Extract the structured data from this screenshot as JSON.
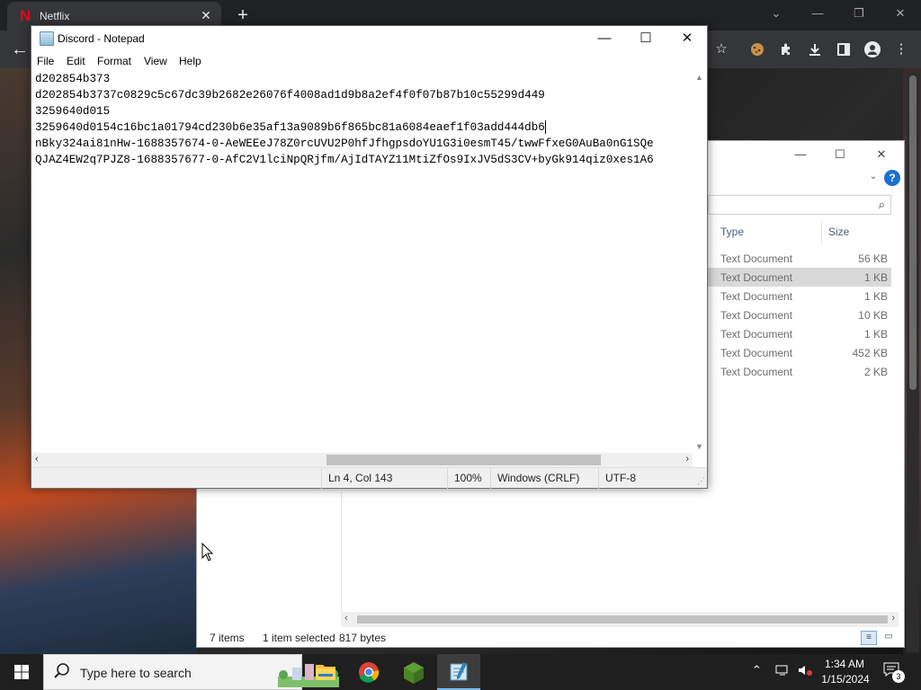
{
  "chrome": {
    "tab_title": "Netflix",
    "tab_close": "✕",
    "new_tab": "+",
    "back": "←",
    "minimize": "—",
    "restore": "❐",
    "close": "✕",
    "toolbar_icons": [
      "star-icon",
      "cookie-icon",
      "extensions-icon",
      "download-icon",
      "side-panel-icon",
      "profile-icon",
      "menu-icon"
    ]
  },
  "explorer": {
    "columns": {
      "type": "Type",
      "size": "Size"
    },
    "files": [
      {
        "type": "Text Document",
        "size": "56 KB",
        "selected": false
      },
      {
        "type": "Text Document",
        "size": "1 KB",
        "selected": true
      },
      {
        "type": "Text Document",
        "size": "1 KB",
        "selected": false
      },
      {
        "type": "Text Document",
        "size": "10 KB",
        "selected": false
      },
      {
        "type": "Text Document",
        "size": "1 KB",
        "selected": false
      },
      {
        "type": "Text Document",
        "size": "452 KB",
        "selected": false
      },
      {
        "type": "Text Document",
        "size": "2 KB",
        "selected": false
      }
    ],
    "status": {
      "items": "7 items",
      "selected": "1 item selected",
      "bytes": "817 bytes"
    },
    "help": "?"
  },
  "notepad": {
    "title": "Discord - Notepad",
    "menu": [
      "File",
      "Edit",
      "Format",
      "View",
      "Help"
    ],
    "lines": [
      "d202854b373",
      "d202854b3737c0829c5c67dc39b2682e26076f4008ad1d9b8a2ef4f0f07b87b10c55299d449",
      "3259640d015",
      "3259640d0154c16bc1a01794cd230b6e35af13a9089b6f865bc81a6084eaef1f03add444db6",
      "nBky324ai81nHw-1688357674-0-AeWEEeJ78Z0rcUVU2P0hfJfhgpsdoYU1G3i0esmT45/twwFfxeG0AuBa0nG1SQe",
      "QJAZ4EW2q7PJZ8-1688357677-0-AfC2V1lciNpQRjfm/AjIdTAYZ11MtiZfOs9IxJV5dS3CV+byGk914qiz0xes1A6"
    ],
    "status": {
      "position": "Ln 4, Col 143",
      "zoom": "100%",
      "line_ending": "Windows (CRLF)",
      "encoding": "UTF-8"
    }
  },
  "taskbar": {
    "search_placeholder": "Type here to search",
    "apps": [
      "file-explorer",
      "chrome",
      "minecraft-launcher",
      "notepad"
    ],
    "time": "1:34 AM",
    "date": "1/15/2024",
    "notifications": "3"
  }
}
